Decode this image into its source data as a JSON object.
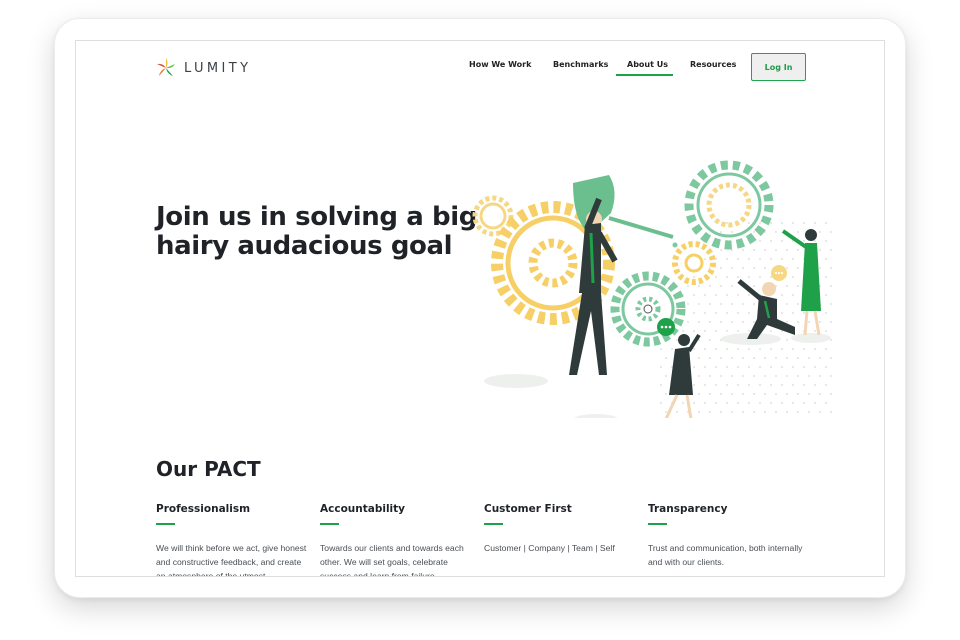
{
  "brand": {
    "name": "LUMITY"
  },
  "nav": {
    "items": [
      {
        "label": "How We Work"
      },
      {
        "label": "Benchmarks"
      },
      {
        "label": "About Us",
        "active": true
      },
      {
        "label": "Resources"
      }
    ],
    "login_label": "Log In"
  },
  "hero": {
    "title_line1": "Join us in solving a big",
    "title_line2": "hairy audacious goal",
    "illustration": "people-turning-gears-illustration"
  },
  "pact": {
    "title": "Our PACT",
    "pillars": [
      {
        "title": "Professionalism",
        "text": "We will think before we act, give honest and constructive feedback, and create an atmosphere of the utmost"
      },
      {
        "title": "Accountability",
        "text": "Towards our clients and towards each other. We will set goals, celebrate success and learn from failure."
      },
      {
        "title": "Customer First",
        "text": "Customer | Company | Team | Self"
      },
      {
        "title": "Transparency",
        "text": "Trust and communication, both internally and with our clients."
      }
    ]
  },
  "colors": {
    "accent_green": "#1fa149",
    "gear_green": "#7ec8a0",
    "gear_yellow": "#f6cf66",
    "text_dark": "#1f2328"
  }
}
